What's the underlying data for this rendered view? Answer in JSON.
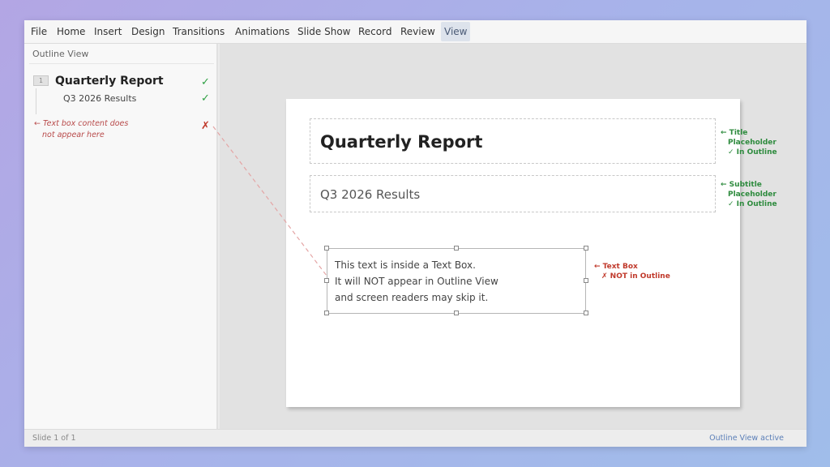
{
  "menu": [
    "File",
    "Home",
    "Insert",
    "Design",
    "Transitions",
    "Animations",
    "Slide Show",
    "Record",
    "Review",
    "View"
  ],
  "menu_active": "View",
  "sidebar": {
    "header": "Outline View",
    "slide_number": "1",
    "outline_title": "Quarterly Report",
    "outline_subtitle": "Q3 2026 Results",
    "check_mark": "✓",
    "cross_mark": "✗",
    "note_line1": "← Text box content does",
    "note_line2": "not appear here"
  },
  "slide": {
    "title": "Quarterly Report",
    "subtitle": "Q3 2026 Results",
    "textbox_lines": [
      "This text is inside a Text Box.",
      "It will NOT appear in Outline View",
      "and screen readers may skip it."
    ]
  },
  "annotations": {
    "title": [
      "← Title",
      "Placeholder",
      "✓ In Outline"
    ],
    "subtitle": [
      "← Subtitle",
      "Placeholder",
      "✓ In Outline"
    ],
    "textbox": [
      "← Text Box",
      "✗ NOT in Outline"
    ]
  },
  "status": {
    "left": "Slide 1 of 1",
    "right": "Outline View active"
  },
  "colors": {
    "check_green": "#2ea043",
    "cross_red": "#c0392b",
    "status_blue": "#5b7fb8"
  }
}
